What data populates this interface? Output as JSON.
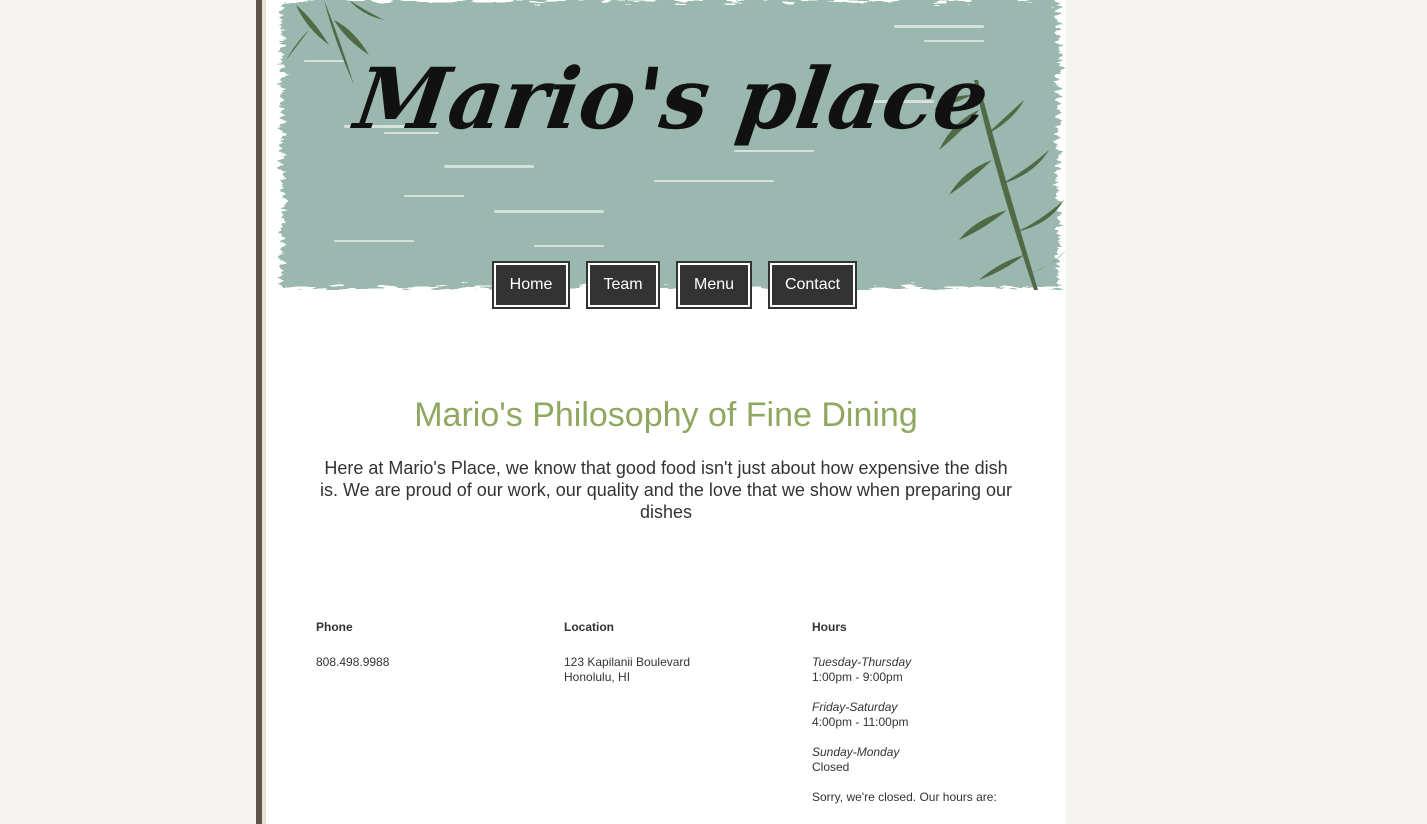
{
  "header": {
    "logo_text": "Mario's place"
  },
  "nav": {
    "home": "Home",
    "team": "Team",
    "menu": "Menu",
    "contact": "Contact"
  },
  "philosophy": {
    "title": "Mario's Philosophy of Fine Dining",
    "text": "Here at Mario's Place, we know that good food isn't just about how expensive the dish is. We are proud of our work, our quality and the love that we show when preparing our dishes"
  },
  "info": {
    "phone": {
      "label": "Phone",
      "value": "808.498.9988"
    },
    "location": {
      "label": "Location",
      "line1": "123 Kapilanii Boulevard",
      "line2": "Honolulu, HI"
    },
    "hours": {
      "label": "Hours",
      "groups": [
        {
          "days": "Tuesday-Thursday",
          "time": "1:00pm - 9:00pm"
        },
        {
          "days": "Friday-Saturday",
          "time": "4:00pm - 11:00pm"
        },
        {
          "days": "Sunday-Monday",
          "time": "Closed"
        }
      ],
      "status": "Sorry, we're closed. Our hours are:"
    }
  },
  "colors": {
    "banner": "#9ab8af",
    "title_green": "#8fa860",
    "button_bg": "#333333",
    "side_border": "#5f5547"
  }
}
